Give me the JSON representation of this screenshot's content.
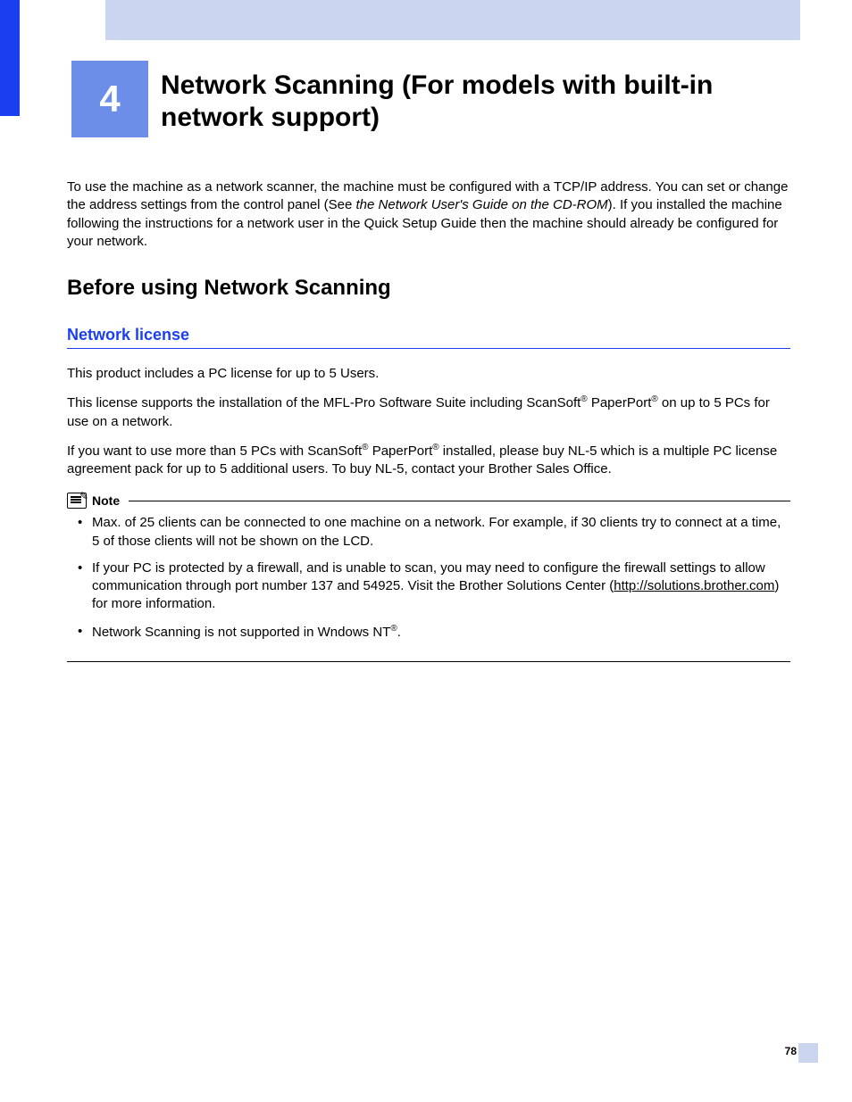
{
  "chapter": {
    "number": "4",
    "title": "Network Scanning (For models with built-in network support)"
  },
  "intro": {
    "text_a": "To use the machine as a network scanner, the machine must be configured with a TCP/IP address. You can set or change the address settings from the control panel (See ",
    "italic": "the Network User's Guide on the CD-ROM",
    "text_b": "). If you installed the machine following the instructions for a network user in the Quick Setup Guide then the machine should already be configured for your network."
  },
  "section": {
    "heading": "Before using Network Scanning"
  },
  "subsection": {
    "heading": "Network license",
    "p1": "This product includes a PC license for up to 5 Users.",
    "p2a": "This license supports the installation of the MFL-Pro Software Suite including ScanSoft",
    "reg": "®",
    "p2b": " PaperPort",
    "p2c": " on up to 5 PCs for use on a network.",
    "p3a": "If you want to use more than 5 PCs with ScanSoft",
    "p3b": " PaperPort",
    "p3c": " installed, please buy NL-5 which is a multiple PC license agreement pack for up to 5 additional users. To buy NL-5, contact your Brother Sales Office."
  },
  "note": {
    "label": "Note",
    "item1": "Max. of 25 clients can be connected to one machine on a network. For example, if 30 clients try to connect at a time, 5 of those clients will not be shown on the LCD.",
    "item2a": "If your PC is protected by a firewall, and is unable to scan, you may need to configure the firewall settings to allow communication through port number 137 and 54925. Visit the Brother Solutions Center (",
    "item2_link": "http://solutions.brother.com",
    "item2b": ") for more information.",
    "item3a": "Network Scanning is not supported in Wndows NT",
    "item3b": "."
  },
  "page_number": "78"
}
